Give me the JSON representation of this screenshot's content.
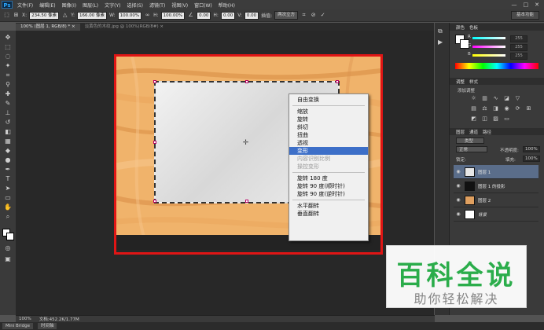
{
  "app": {
    "logo": "Ps"
  },
  "menu": [
    "文件(F)",
    "编辑(E)",
    "图像(I)",
    "图层(L)",
    "文字(Y)",
    "选择(S)",
    "滤镜(T)",
    "视图(V)",
    "窗口(W)",
    "帮助(H)"
  ],
  "window_controls": {
    "minimize": "—",
    "maximize": "□",
    "close": "✕"
  },
  "options": {
    "x_label": "X:",
    "x_value": "234.50 像素",
    "y_label": "Y:",
    "y_value": "166.00 像素",
    "w_label": "W:",
    "w_value": "100.00%",
    "h_label": "H:",
    "h_value": "100.00%",
    "angle_value": "0.00",
    "hskew_label": "H:",
    "hskew_value": "0.00",
    "vskew_label": "V:",
    "vskew_value": "0.00",
    "interp_label": "插值:",
    "interp_value": "两次立方",
    "workspace": "基本功能"
  },
  "tabs": [
    {
      "label": "100% (图层 1, RGB/8) *",
      "close": "×"
    },
    {
      "label": "淡黄色的木纹.jpg @ 100%(RGB/8#)",
      "close": "×"
    }
  ],
  "context_menu": [
    {
      "label": "自由变换",
      "state": "normal"
    },
    {
      "sep": true
    },
    {
      "label": "缩放",
      "state": "normal"
    },
    {
      "label": "旋转",
      "state": "normal"
    },
    {
      "label": "斜切",
      "state": "normal"
    },
    {
      "label": "扭曲",
      "state": "normal"
    },
    {
      "label": "透视",
      "state": "normal"
    },
    {
      "label": "变形",
      "state": "highlight"
    },
    {
      "label": "内容识别比例",
      "state": "disabled"
    },
    {
      "label": "操控变形",
      "state": "disabled"
    },
    {
      "sep": true
    },
    {
      "label": "旋转 180 度",
      "state": "normal"
    },
    {
      "label": "旋转 90 度(顺时针)",
      "state": "normal"
    },
    {
      "label": "旋转 90 度(逆时针)",
      "state": "normal"
    },
    {
      "sep": true
    },
    {
      "label": "水平翻转",
      "state": "normal"
    },
    {
      "label": "垂直翻转",
      "state": "normal"
    }
  ],
  "color_panel": {
    "tabs": [
      "颜色",
      "色板"
    ],
    "sliders": [
      {
        "letter": "R",
        "value": "255",
        "color": "#ff4040"
      },
      {
        "letter": "G",
        "value": "255",
        "color": "#40ff40"
      },
      {
        "letter": "B",
        "value": "255",
        "color": "#6060ff"
      }
    ]
  },
  "adjust_panel": {
    "tabs": [
      "调整",
      "样式"
    ],
    "subtitle": "添加调整"
  },
  "layers_panel": {
    "tabs": [
      "图层",
      "通道",
      "路径"
    ],
    "kind": "类型",
    "blend": "正常",
    "opacity_label": "不透明度:",
    "opacity_value": "100%",
    "lock_label": "锁定:",
    "fill_label": "填充:",
    "fill_value": "100%",
    "layers": [
      {
        "name": "图层 1",
        "selected": true,
        "thumb": "#e6e6e6"
      },
      {
        "name": "图层 1 的投影",
        "selected": false,
        "thumb": "#111111"
      },
      {
        "name": "图层 2",
        "selected": false,
        "thumb": "#e0a060"
      },
      {
        "name": "背景",
        "selected": false,
        "thumb": "#ffffff"
      }
    ]
  },
  "status": {
    "zoom": "100%",
    "doc": "文档:452.2K/1.77M"
  },
  "bottom_tabs": [
    "Mini Bridge",
    "时间轴"
  ],
  "watermark": {
    "big": "百科全说",
    "small": "助你轻松解决"
  }
}
